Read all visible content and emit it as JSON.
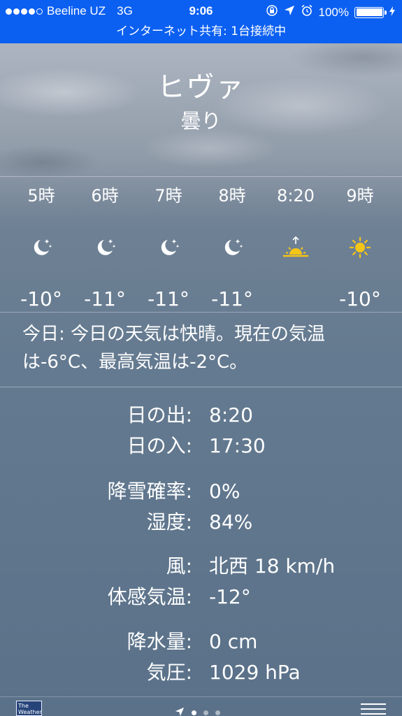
{
  "statusbar": {
    "carrier": "Beeline UZ",
    "network": "3G",
    "time": "9:06",
    "battery_text": "100%",
    "battery_level": 1.0,
    "hotspot_text": "インターネット共有: 1台接続中"
  },
  "header": {
    "city": "ヒヴァ",
    "condition": "曇り"
  },
  "hourly": [
    {
      "time": "5時",
      "icon": "moon-stars-icon",
      "temp": "-10°"
    },
    {
      "time": "6時",
      "icon": "moon-stars-icon",
      "temp": "-11°"
    },
    {
      "time": "7時",
      "icon": "moon-stars-icon",
      "temp": "-11°"
    },
    {
      "time": "8時",
      "icon": "moon-stars-icon",
      "temp": "-11°"
    },
    {
      "time": "8:20",
      "icon": "sunrise-icon",
      "temp": ""
    },
    {
      "time": "9時",
      "icon": "sun-icon",
      "temp": "-10°"
    }
  ],
  "summary": "今日: 今日の天気は快晴。現在の気温は-6°C、最高気温は-2°C。",
  "details": [
    {
      "label": "日の出:",
      "value": "8:20"
    },
    {
      "label": "日の入:",
      "value": "17:30"
    },
    {
      "label": "降雪確率:",
      "value": "0%"
    },
    {
      "label": "湿度:",
      "value": "84%"
    },
    {
      "label": "風:",
      "value": "北西 18 km/h"
    },
    {
      "label": "体感気温:",
      "value": "-12°"
    },
    {
      "label": "降水量:",
      "value": "0 cm"
    },
    {
      "label": "気圧:",
      "value": "1029 hPa"
    }
  ],
  "footer": {
    "logo_text": "The Weather",
    "page_count": 3,
    "current_page": 1
  },
  "colors": {
    "statusbar_bg": "#0b60f2",
    "sun_yellow": "#f5c518"
  }
}
